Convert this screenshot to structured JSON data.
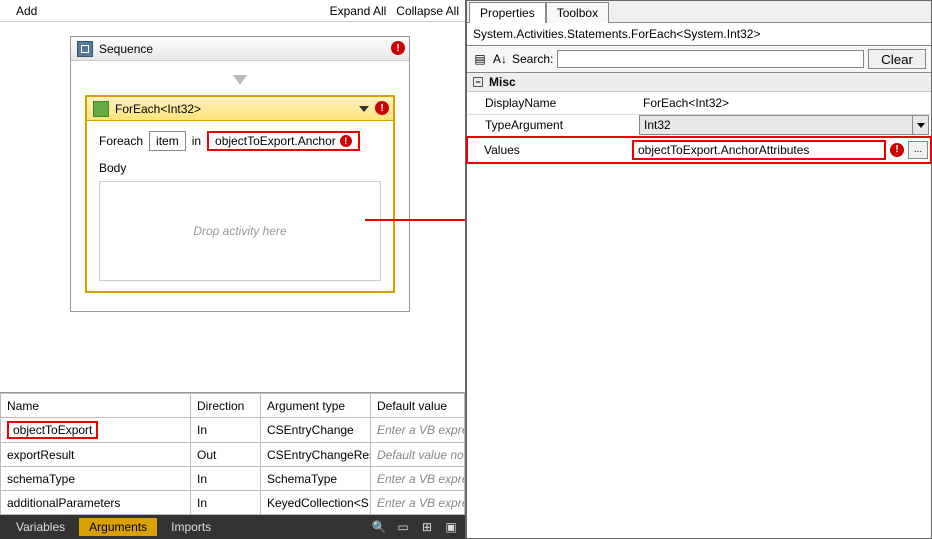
{
  "designer": {
    "toolbar": {
      "add": "Add",
      "expand": "Expand All",
      "collapse": "Collapse All"
    },
    "sequence": {
      "title": "Sequence",
      "error": "!"
    },
    "foreach": {
      "title": "ForEach<Int32>",
      "error": "!",
      "foreach_label": "Foreach",
      "item_value": "item",
      "in_label": "in",
      "in_value": "objectToExport.Anchor",
      "body_label": "Body",
      "drop_hint": "Drop activity here"
    }
  },
  "args": {
    "headers": {
      "name": "Name",
      "direction": "Direction",
      "type": "Argument type",
      "default": "Default value"
    },
    "rows": [
      {
        "name": "objectToExport",
        "direction": "In",
        "type": "CSEntryChange",
        "default": "Enter a VB express",
        "ph": true,
        "red": true
      },
      {
        "name": "exportResult",
        "direction": "Out",
        "type": "CSEntryChangeRes",
        "default": "Default value not su",
        "ph": true,
        "red": false
      },
      {
        "name": "schemaType",
        "direction": "In",
        "type": "SchemaType",
        "default": "Enter a VB express",
        "ph": true,
        "red": false
      },
      {
        "name": "additionalParameters",
        "direction": "In",
        "type": "KeyedCollection<S",
        "default": "Enter a VB express",
        "ph": true,
        "red": false
      }
    ]
  },
  "bottom": {
    "variables": "Variables",
    "arguments": "Arguments",
    "imports": "Imports"
  },
  "properties": {
    "tab_properties": "Properties",
    "tab_toolbox": "Toolbox",
    "breadcrumb": "System.Activities.Statements.ForEach<System.Int32>",
    "search_label": "Search:",
    "clear": "Clear",
    "misc": "Misc",
    "rows": {
      "displayname_label": "DisplayName",
      "displayname_value": "ForEach<Int32>",
      "typearg_label": "TypeArgument",
      "typearg_value": "Int32",
      "values_label": "Values",
      "values_value": "objectToExport.AnchorAttributes"
    },
    "error": "!",
    "ellipsis": "..."
  }
}
